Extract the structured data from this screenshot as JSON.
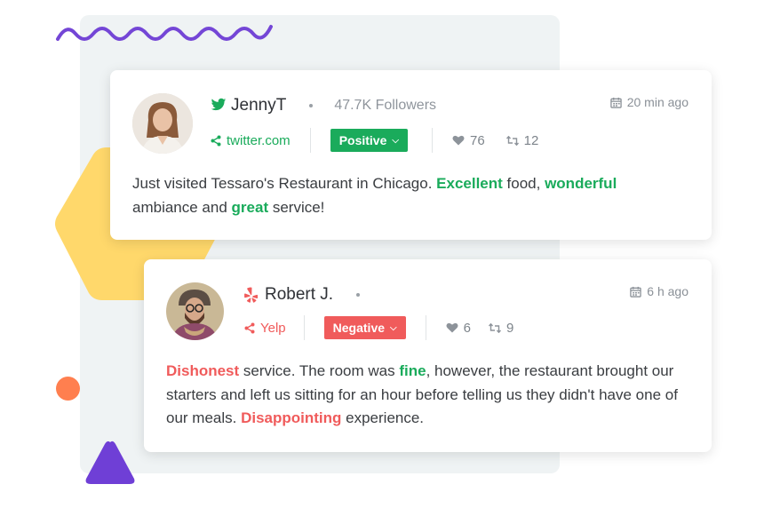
{
  "colors": {
    "positive": "#1aab5b",
    "negative": "#f05b5b",
    "twitter": "#1aab5b",
    "yelp": "#f05b5b",
    "squiggle": "#7446d6",
    "hexagon": "#ffd86b",
    "dot": "#ff7f4f",
    "triangle": "#6f3fd6"
  },
  "posts": [
    {
      "author": "JennyT",
      "source_icon": "twitter-icon",
      "followers": "47.7K Followers",
      "time": "20 min ago",
      "source": "twitter.com",
      "sentiment": "Positive",
      "likes": "76",
      "retweets": "12",
      "text": {
        "p1": "Just visited Tessaro's Restaurant in Chicago. ",
        "w1": "Excellent",
        "p2": " food, ",
        "w2": "wonderful",
        "p3": " ambiance and ",
        "w3": "great",
        "p4": " service!"
      }
    },
    {
      "author": "Robert J.",
      "source_icon": "yelp-icon",
      "time": "6 h ago",
      "source": "Yelp",
      "sentiment": "Negative",
      "likes": "6",
      "retweets": "9",
      "text": {
        "w1": "Dishonest",
        "p1": " service. The room was ",
        "w2": "fine",
        "p2": ", however, the restaurant brought our starters and left us sitting for an hour before telling us they didn't have one of our meals. ",
        "w3": "Disappointing",
        "p3": " experience."
      }
    }
  ]
}
